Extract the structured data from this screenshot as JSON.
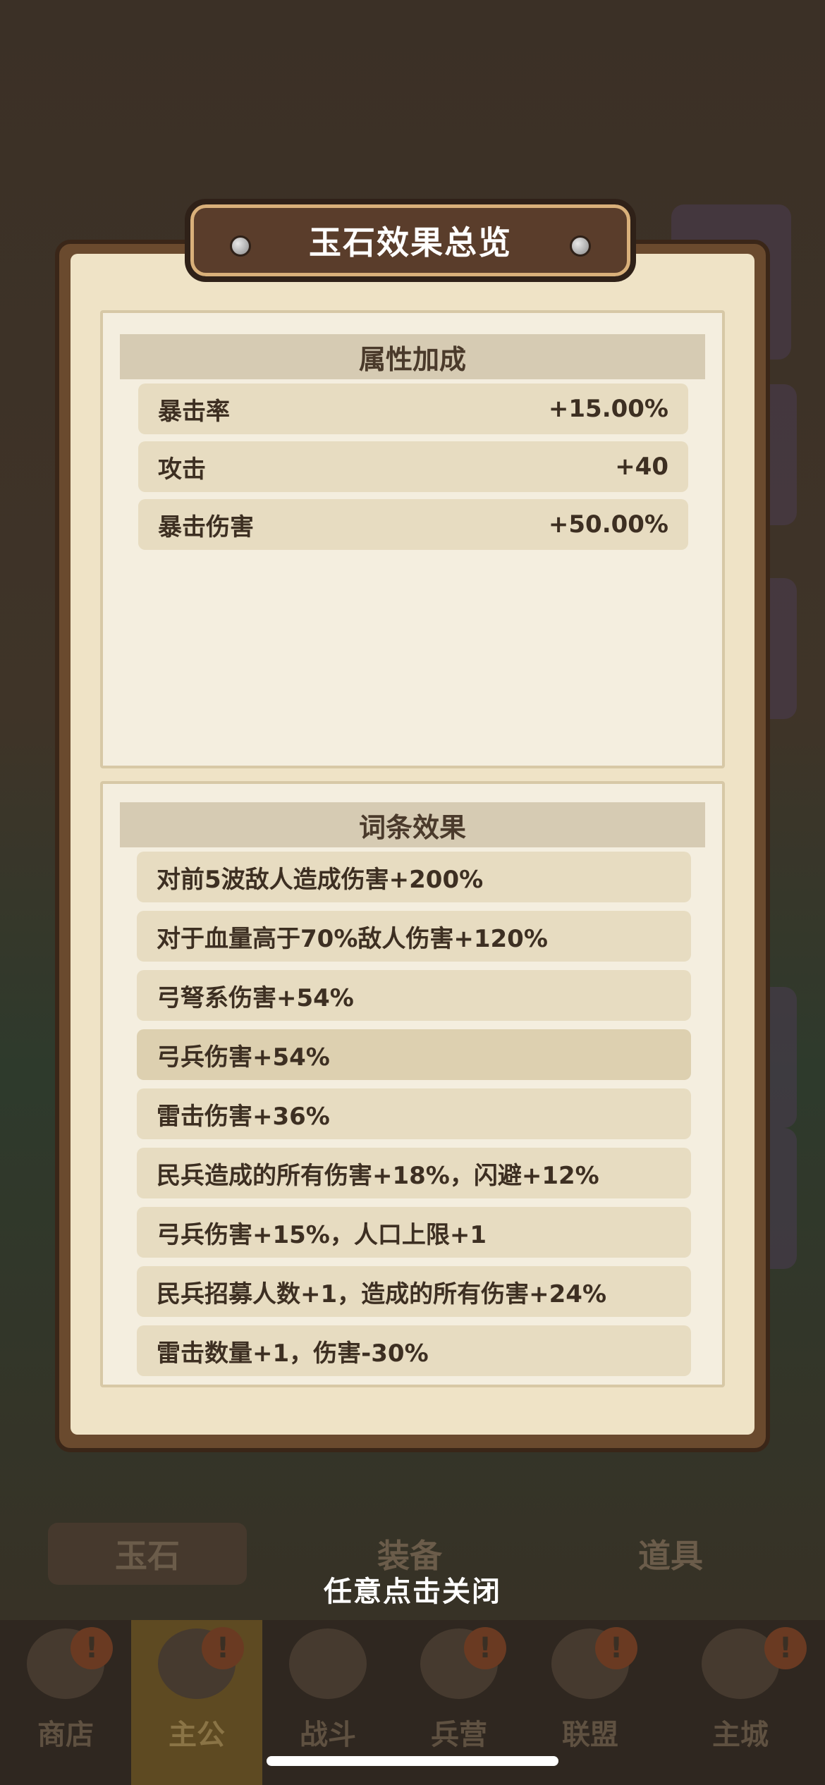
{
  "modal": {
    "title": "玉石效果总览",
    "attributes_section": {
      "header": "属性加成",
      "rows": [
        {
          "label": "暴击率",
          "value": "+15.00%"
        },
        {
          "label": "攻击",
          "value": "+40"
        },
        {
          "label": "暴击伤害",
          "value": "+50.00%"
        }
      ]
    },
    "effects_section": {
      "header": "词条效果",
      "rows": [
        "对前5波敌人造成伤害+200%",
        "对于血量高于70%敌人伤害+120%",
        "弓弩系伤害+54%",
        "弓兵伤害+54%",
        "雷击伤害+36%",
        "民兵造成的所有伤害+18%，闪避+12%",
        "弓兵伤害+15%，人口上限+1",
        "民兵招募人数+1，造成的所有伤害+24%",
        "雷击数量+1，伤害-30%"
      ]
    },
    "close_hint": "任意点击关闭"
  },
  "background": {
    "inventory_tabs": [
      "玉石",
      "装备",
      "道具"
    ],
    "bottom_nav": [
      {
        "label": "商店",
        "icon": "shop-icon",
        "badge": "!"
      },
      {
        "label": "主公",
        "icon": "lord-icon",
        "badge": "!",
        "active": true
      },
      {
        "label": "战斗",
        "icon": "battle-icon",
        "badge": ""
      },
      {
        "label": "兵营",
        "icon": "barracks-icon",
        "badge": "!"
      },
      {
        "label": "联盟",
        "icon": "alliance-icon",
        "badge": "!"
      },
      {
        "label": "主城",
        "icon": "city-icon",
        "badge": "!"
      }
    ]
  },
  "colors": {
    "overlay": "#3a2f24",
    "frame": "#6a4a2e",
    "paper": "#efe3c6",
    "row": "#e7dcc1",
    "text": "#3d2f22",
    "accent_gold": "#d9b07a"
  }
}
